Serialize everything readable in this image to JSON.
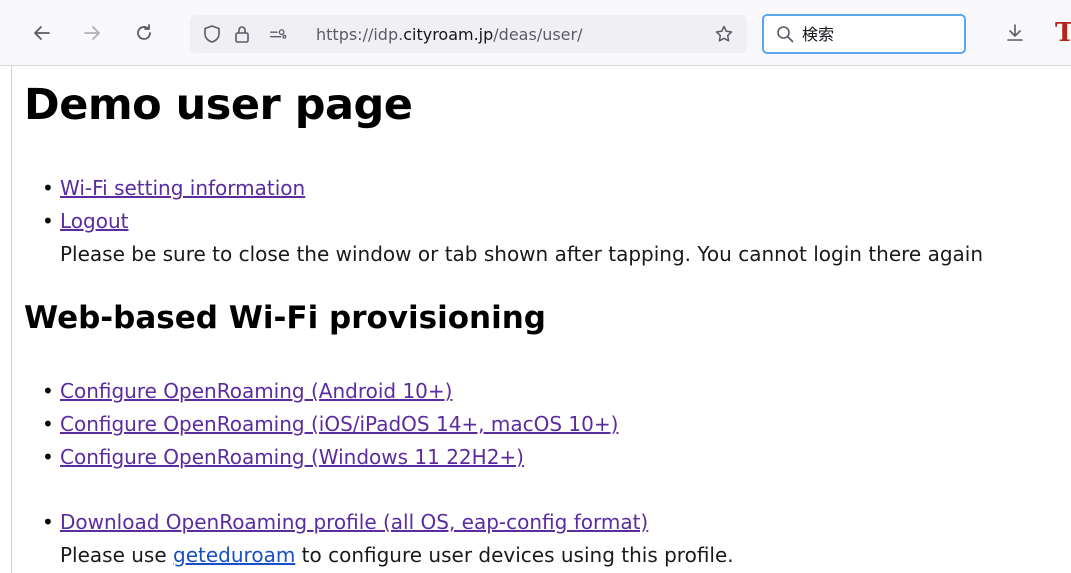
{
  "browser": {
    "url_prefix": "https://idp.",
    "url_host": "cityroam.jp",
    "url_path": "/deas/user/",
    "search_placeholder": "検索",
    "extension_label": "T"
  },
  "page": {
    "title": "Demo user page",
    "top_links": [
      {
        "label": "Wi-Fi setting information"
      },
      {
        "label": "Logout",
        "note": "Please be sure to close the window or tab shown after tapping. You cannot login there again"
      }
    ],
    "section_title": "Web-based Wi-Fi provisioning",
    "configure_links": [
      {
        "label": "Configure OpenRoaming (Android 10+)"
      },
      {
        "label": "Configure OpenRoaming (iOS/iPadOS 14+, macOS 10+)"
      },
      {
        "label": "Configure OpenRoaming (Windows 11 22H2+)"
      }
    ],
    "download": {
      "label": "Download OpenRoaming profile (all OS, eap-config format)",
      "note_before": "Please use ",
      "note_link": "geteduroam",
      "note_after": " to configure user devices using this profile."
    }
  }
}
